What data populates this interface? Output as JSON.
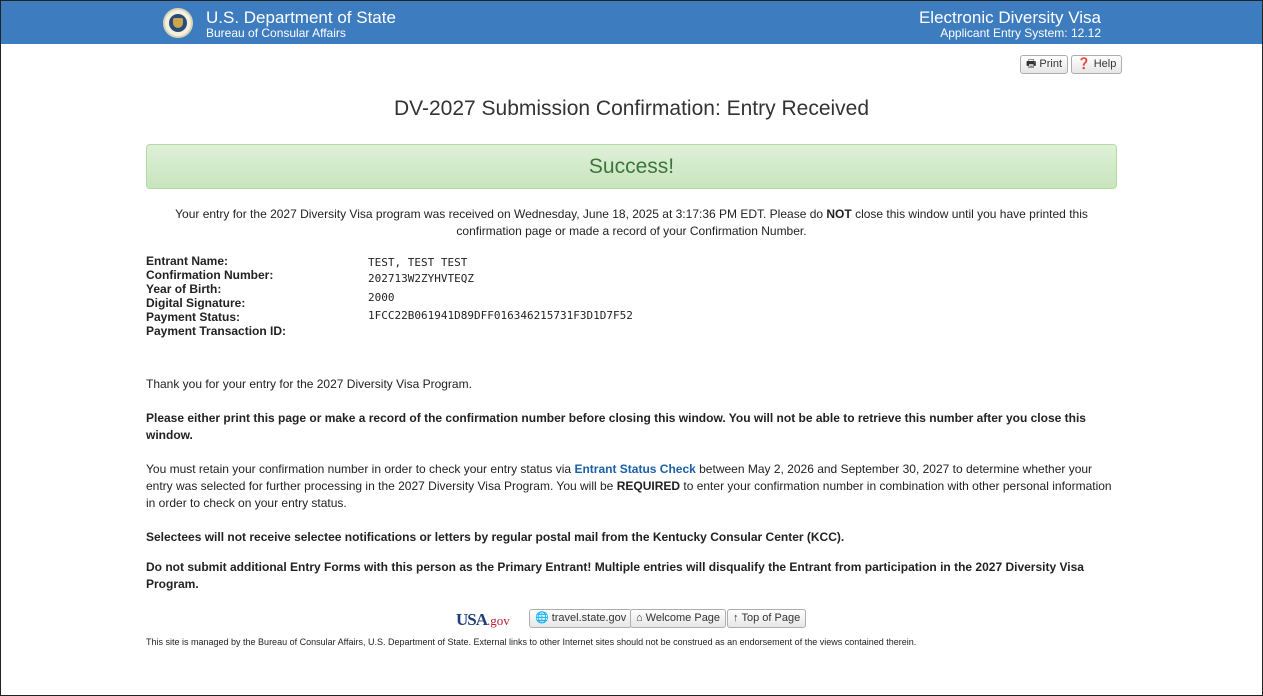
{
  "header": {
    "department_title": "U.S. Department of State",
    "department_subtitle": "Bureau of Consular Affairs",
    "system_title": "Electronic Diversity Visa",
    "system_subtitle": "Applicant Entry System: 12.12",
    "bar_color": "#3e7cc0"
  },
  "toolbar": {
    "print_label": "Print",
    "help_label": "Help",
    "print_icon": "printer-icon",
    "help_icon": "question-circle-icon"
  },
  "page": {
    "title": "DV-2027 Submission Confirmation: Entry Received"
  },
  "alert": {
    "message": "Success!",
    "color": "#3c763d",
    "background": "#dff0d8"
  },
  "intro": {
    "before_bold": "Your entry for the 2027 Diversity Visa program was received on Wednesday, June 18, 2025 at 3:17:36 PM EDT. Please do ",
    "bold": "NOT",
    "after_bold": " close this window until you have printed this confirmation page or made a record of your Confirmation Number."
  },
  "fields": [
    {
      "label": "Entrant Name:",
      "value": "TEST, TEST TEST"
    },
    {
      "label": "Confirmation Number:",
      "value": "202713W2ZYHVTEQZ"
    },
    {
      "label": "Year of Birth:",
      "value": "2000"
    },
    {
      "label": "Digital Signature:",
      "value": "1FCC22B061941D89DFF016346215731F3D1D7F52"
    },
    {
      "label": "Payment Status:",
      "value": ""
    },
    {
      "label": "Payment Transaction ID:",
      "value": ""
    }
  ],
  "paragraphs": {
    "thanks": "Thank you for your entry for the 2027 Diversity Visa Program.",
    "print_warning": "Please either print this page or make a record of the confirmation number before closing this window. You will not be able to retrieve this number after you close this window.",
    "retain_before_link": "You must retain your confirmation number in order to check your entry status via ",
    "retain_link": "Entrant Status Check",
    "retain_after_link": " between May 2, 2026 and September 30, 2027 to determine whether your entry was selected for further processing in the 2027 Diversity Visa Program. You will be ",
    "retain_required": "REQUIRED",
    "retain_end": " to enter your confirmation number in combination with other personal information in order to check on your entry status.",
    "selectees": "Selectees will not receive selectee notifications or letters by regular postal mail from the Kentucky Consular Center (KCC).",
    "no_additional": "Do not submit additional Entry Forms with this person as the Primary Entrant! Multiple entries will disqualify the Entrant from participation in the 2027 Diversity Visa Program."
  },
  "footer": {
    "usa_logo_usa": "USA",
    "usa_logo_gov": ".gov",
    "travel_label": "travel.state.gov",
    "welcome_label": "Welcome Page",
    "top_label": "Top of Page",
    "travel_icon": "globe-icon",
    "welcome_icon": "home-icon",
    "top_icon": "arrow-up-icon",
    "note": "This site is managed by the Bureau of Consular Affairs, U.S. Department of State. External links to other Internet sites should not be construed as an endorsement of the views contained therein."
  }
}
